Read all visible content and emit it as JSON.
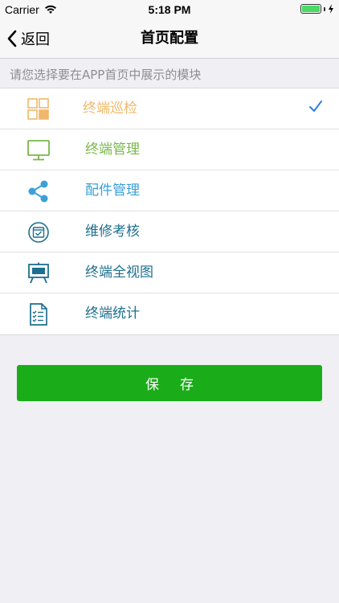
{
  "status_bar": {
    "carrier": "Carrier",
    "time": "5:18 PM",
    "battery_level": 1.0
  },
  "nav": {
    "back_label": "返回",
    "title": "首页配置"
  },
  "hint": "请您选择要在APP首页中展示的模块",
  "modules": [
    {
      "label": "终端巡检",
      "icon": "grid-icon",
      "color": "#f0b86a",
      "selected": true
    },
    {
      "label": "终端管理",
      "icon": "monitor-icon",
      "color": "#78b84a",
      "selected": false
    },
    {
      "label": "配件管理",
      "icon": "share-icon",
      "color": "#3aa0d8",
      "selected": false
    },
    {
      "label": "维修考核",
      "icon": "calendar-check-icon",
      "color": "#1d6f8f",
      "selected": false
    },
    {
      "label": "终端全视图",
      "icon": "presentation-board-icon",
      "color": "#1d6f8f",
      "selected": false
    },
    {
      "label": "终端统计",
      "icon": "checklist-document-icon",
      "color": "#1d6f8f",
      "selected": false
    }
  ],
  "check_color": "#2f7fe0",
  "save_label": "保存"
}
